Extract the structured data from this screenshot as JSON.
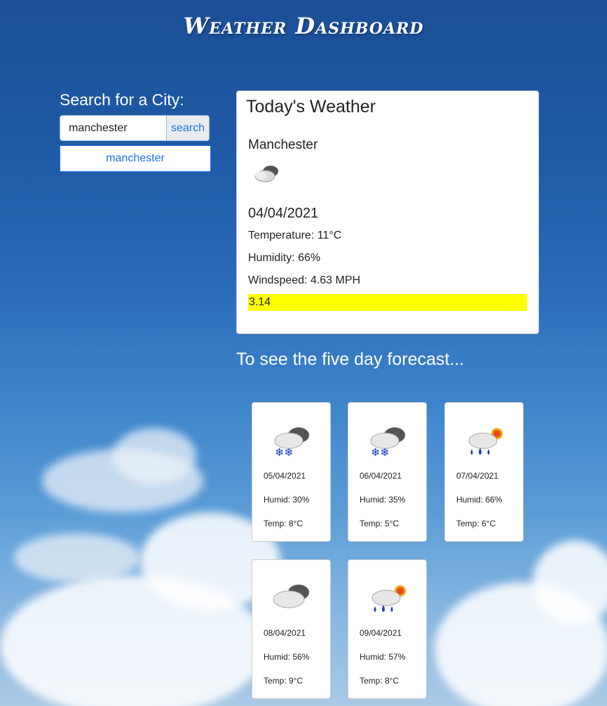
{
  "header": {
    "title": "Weather Dashboard"
  },
  "search": {
    "label": "Search for a City:",
    "input_value": "manchester",
    "button_label": "search",
    "history": [
      "manchester"
    ]
  },
  "today": {
    "heading": "Today's Weather",
    "city": "Manchester",
    "icon": "partly-cloudy-icon",
    "date": "04/04/2021",
    "temperature": "Temperature: 11°C",
    "humidity": "Humidity: 66%",
    "windspeed": "Windspeed: 4.63 MPH",
    "uv_index": "3.14",
    "uv_color": "#ffff00"
  },
  "forecast": {
    "heading": "To see the five day forecast...",
    "days": [
      {
        "date": "05/04/2021",
        "humid": "Humid: 30%",
        "temp": "Temp: 8°C",
        "icon": "snow-cloud-icon"
      },
      {
        "date": "06/04/2021",
        "humid": "Humid: 35%",
        "temp": "Temp: 5°C",
        "icon": "snow-cloud-icon"
      },
      {
        "date": "07/04/2021",
        "humid": "Humid: 66%",
        "temp": "Temp: 6°C",
        "icon": "rain-sun-icon"
      },
      {
        "date": "08/04/2021",
        "humid": "Humid: 56%",
        "temp": "Temp: 9°C",
        "icon": "cloud-icon"
      },
      {
        "date": "09/04/2021",
        "humid": "Humid: 57%",
        "temp": "Temp: 8°C",
        "icon": "rain-sun-icon"
      }
    ]
  }
}
